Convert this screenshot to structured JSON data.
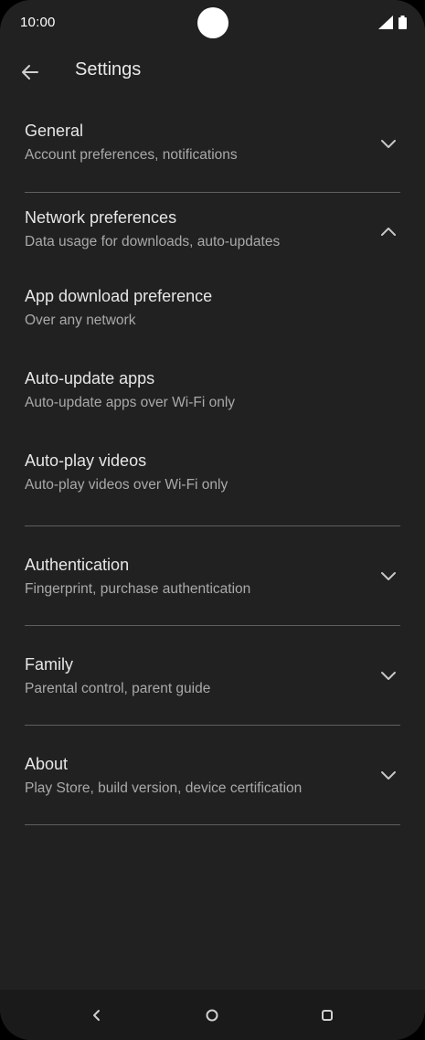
{
  "status_bar": {
    "time": "10:00"
  },
  "app_bar": {
    "title": "Settings"
  },
  "sections": [
    {
      "title": "General",
      "subtitle": "Account preferences, notifications",
      "expanded": false
    },
    {
      "title": "Network preferences",
      "subtitle": "Data usage for downloads, auto-updates",
      "expanded": true,
      "items": [
        {
          "title": "App download preference",
          "subtitle": "Over any network"
        },
        {
          "title": "Auto-update apps",
          "subtitle": "Auto-update apps over Wi-Fi only"
        },
        {
          "title": "Auto-play videos",
          "subtitle": "Auto-play videos over Wi-Fi only"
        }
      ]
    },
    {
      "title": "Authentication",
      "subtitle": "Fingerprint, purchase authentication",
      "expanded": false
    },
    {
      "title": "Family",
      "subtitle": "Parental control, parent guide",
      "expanded": false
    },
    {
      "title": "About",
      "subtitle": "Play Store, build version, device certification",
      "expanded": false
    }
  ],
  "icons": {
    "back": "arrow-back-icon",
    "expand": "chevron-down-icon",
    "collapse": "chevron-up-icon",
    "nav_back": "nav-back-icon",
    "nav_home": "nav-home-icon",
    "nav_recents": "nav-recents-icon"
  }
}
